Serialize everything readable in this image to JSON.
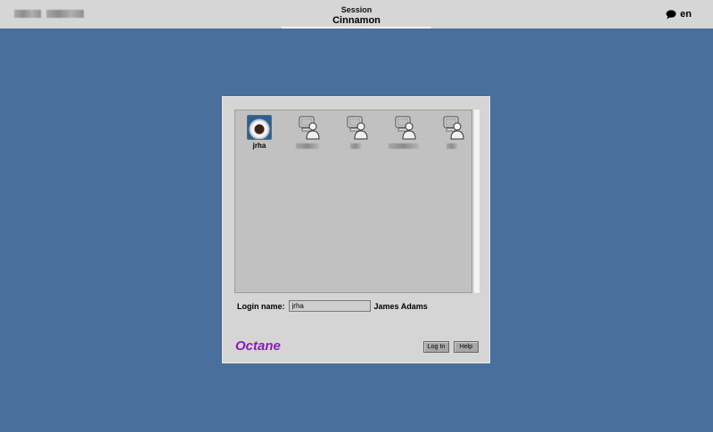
{
  "topbar": {
    "session_label": "Session",
    "session_value": "Cinnamon",
    "language": "en",
    "language_icon": "speech-bubble-icon"
  },
  "users": [
    {
      "name": "jrha",
      "icon": "coffee-cup-avatar-icon"
    },
    {
      "name": "",
      "icon": "generic-user-icon"
    },
    {
      "name": "",
      "icon": "generic-user-icon"
    },
    {
      "name": "",
      "icon": "generic-user-icon"
    },
    {
      "name": "",
      "icon": "generic-user-icon"
    }
  ],
  "login": {
    "label": "Login name:",
    "value": "jrha",
    "full_name": "James Adams"
  },
  "brand": "Octane",
  "buttons": {
    "login": "Log In",
    "help": "Help"
  },
  "colors": {
    "desktop": "#4a6f9c",
    "brand": "#8b1bb8"
  }
}
